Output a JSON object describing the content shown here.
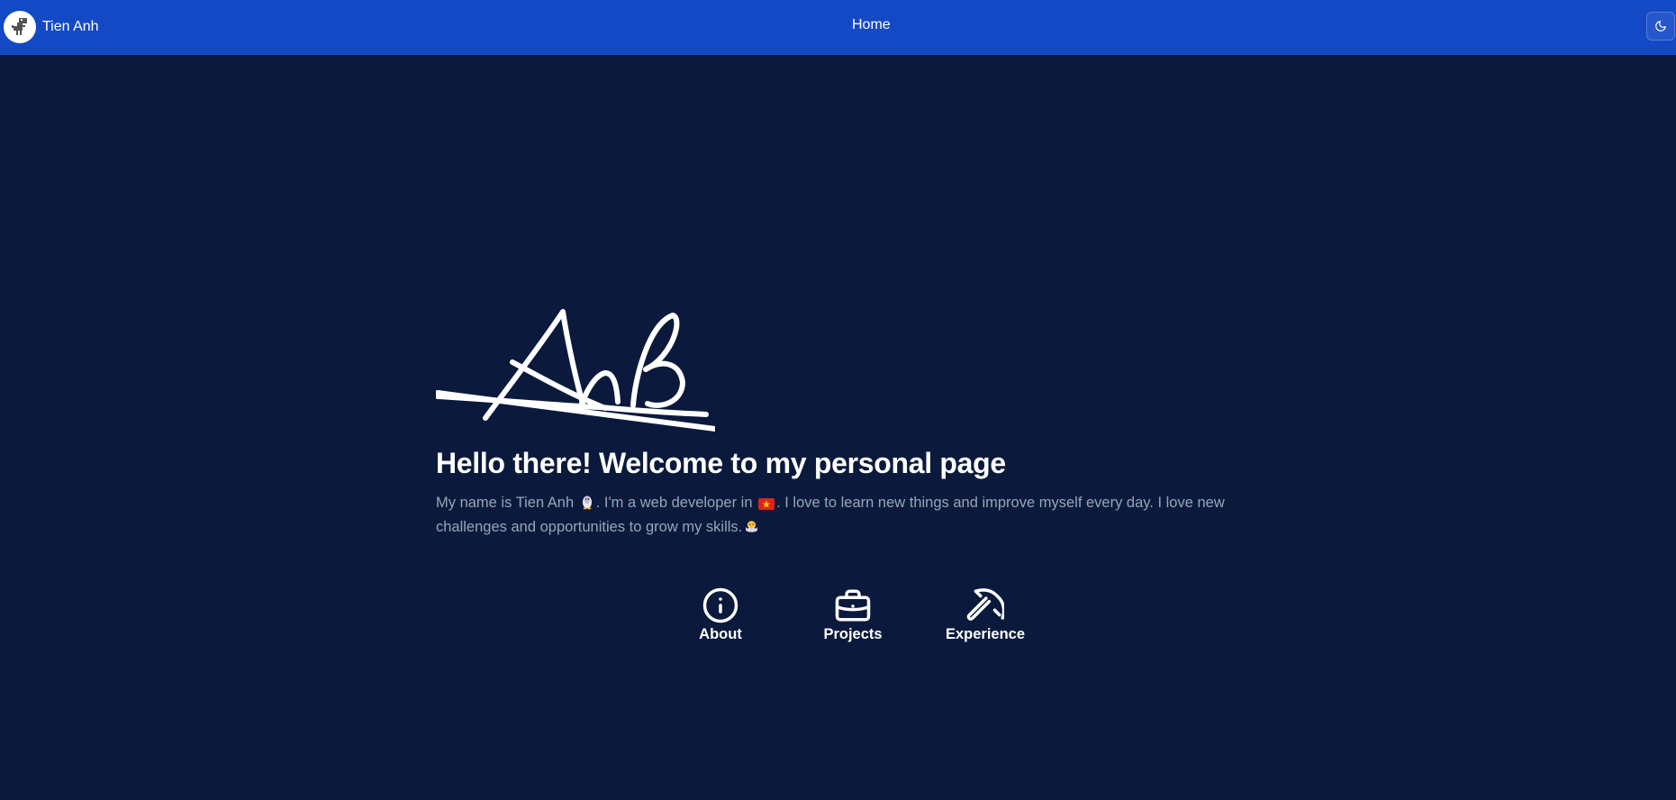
{
  "header": {
    "brand_name": "Tien Anh",
    "nav_home": "Home",
    "theme_toggle_icon": "moon-icon",
    "colors": {
      "background": "#1449c6"
    }
  },
  "hero": {
    "signature_text": "Anh",
    "headline": "Hello there! Welcome to my personal page",
    "intro": {
      "part1": "My name is Tien Anh ",
      "part2": ". I'm a web developer in ",
      "part3": ". I love to learn new things and improve myself every day. I love new challenges and opportunities to grow my skills.",
      "emoji_icons": [
        "penguin-icon",
        "vietnam-flag-icon",
        "hatching-chick-icon"
      ]
    }
  },
  "links": [
    {
      "label": "About",
      "icon": "info-icon"
    },
    {
      "label": "Projects",
      "icon": "briefcase-icon"
    },
    {
      "label": "Experience",
      "icon": "pickaxe-icon"
    }
  ],
  "colors": {
    "page_background": "#0b1a3c",
    "text_primary": "#ffffff",
    "text_muted": "#9aa4b8"
  }
}
